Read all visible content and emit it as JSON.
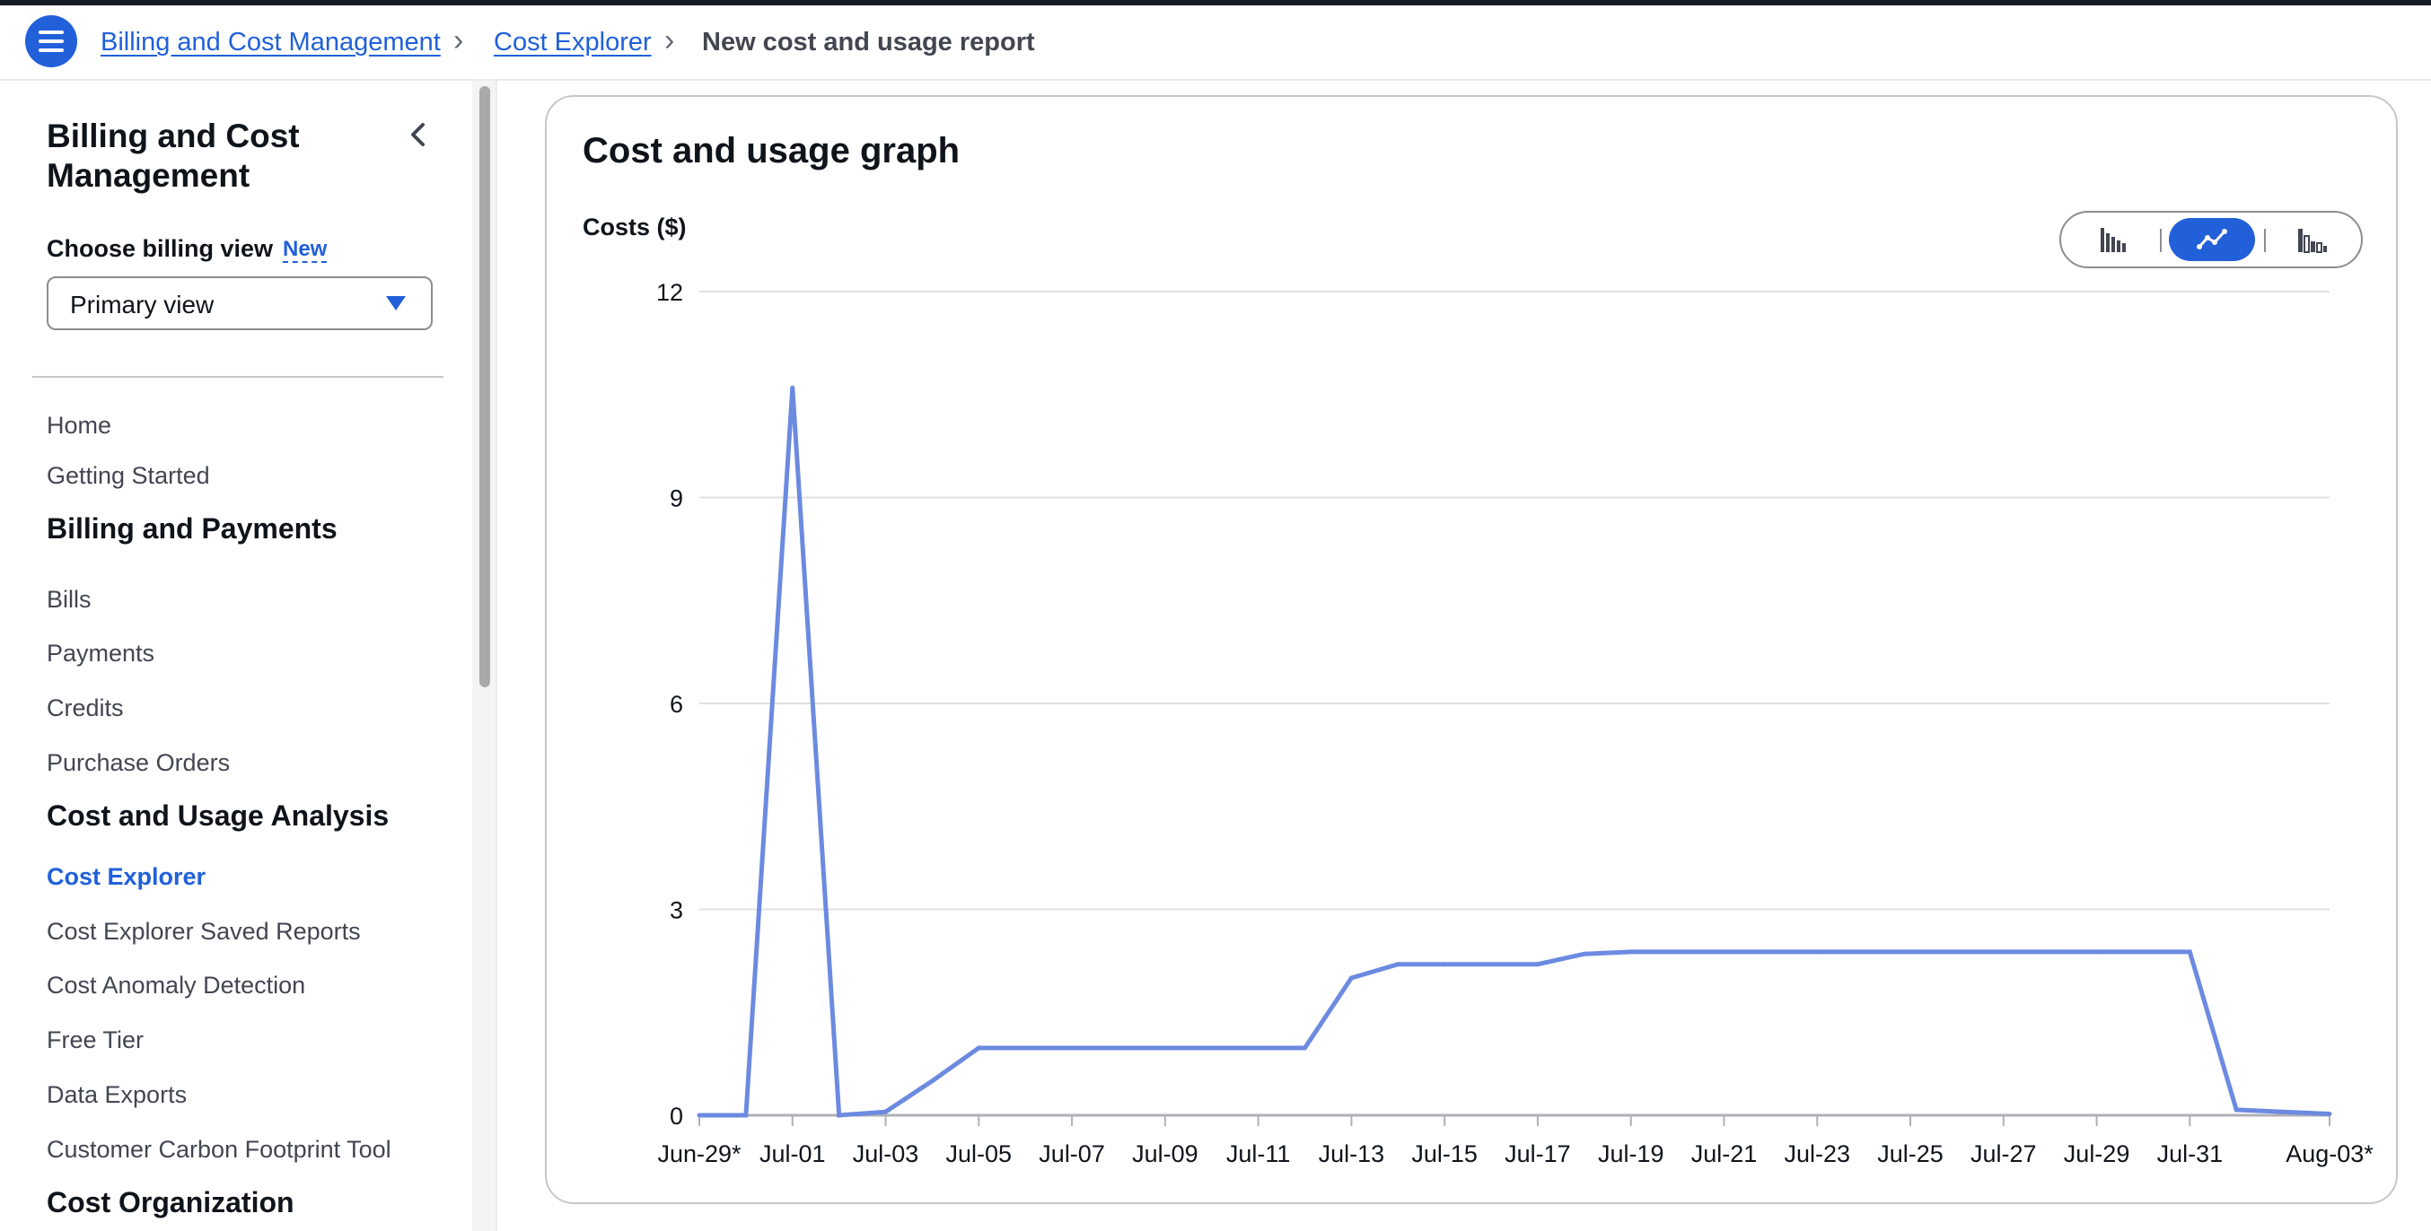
{
  "breadcrumb": {
    "items": [
      "Billing and Cost Management",
      "Cost Explorer"
    ],
    "current": "New cost and usage report"
  },
  "sidebar": {
    "title": "Billing and Cost Management",
    "billing_view_label": "Choose billing view",
    "new_badge": "New",
    "billing_view_value": "Primary view",
    "items": [
      {
        "label": "Home",
        "kind": "link"
      },
      {
        "label": "Getting Started",
        "kind": "link"
      },
      {
        "label": "Billing and Payments",
        "kind": "section"
      },
      {
        "label": "Bills",
        "kind": "link"
      },
      {
        "label": "Payments",
        "kind": "link"
      },
      {
        "label": "Credits",
        "kind": "link"
      },
      {
        "label": "Purchase Orders",
        "kind": "link"
      },
      {
        "label": "Cost and Usage Analysis",
        "kind": "section"
      },
      {
        "label": "Cost Explorer",
        "kind": "link",
        "active": true
      },
      {
        "label": "Cost Explorer Saved Reports",
        "kind": "link"
      },
      {
        "label": "Cost Anomaly Detection",
        "kind": "link"
      },
      {
        "label": "Free Tier",
        "kind": "link"
      },
      {
        "label": "Data Exports",
        "kind": "link"
      },
      {
        "label": "Customer Carbon Footprint Tool",
        "kind": "link"
      },
      {
        "label": "Cost Organization",
        "kind": "section"
      }
    ]
  },
  "card": {
    "title": "Cost and usage graph",
    "chart_type_buttons": [
      {
        "icon": "bar-chart-icon",
        "active": false
      },
      {
        "icon": "line-chart-icon",
        "active": true
      },
      {
        "icon": "stacked-bar-chart-icon",
        "active": false
      }
    ]
  },
  "colors": {
    "accent": "#2160d9",
    "series": "#6b8ae0",
    "grid": "#e0e0e0"
  },
  "chart_data": {
    "type": "line",
    "title": "",
    "ylabel": "Costs ($)",
    "xlabel": "",
    "ylim": [
      0,
      12
    ],
    "yticks": [
      0,
      3,
      6,
      9,
      12
    ],
    "grid": true,
    "x": [
      "Jun-29*",
      "Jun-30",
      "Jul-01",
      "Jul-02",
      "Jul-03",
      "Jul-04",
      "Jul-05",
      "Jul-06",
      "Jul-07",
      "Jul-08",
      "Jul-09",
      "Jul-10",
      "Jul-11",
      "Jul-12",
      "Jul-13",
      "Jul-14",
      "Jul-15",
      "Jul-16",
      "Jul-17",
      "Jul-18",
      "Jul-19",
      "Jul-20",
      "Jul-21",
      "Jul-22",
      "Jul-23",
      "Jul-24",
      "Jul-25",
      "Jul-26",
      "Jul-27",
      "Jul-28",
      "Jul-29",
      "Jul-30",
      "Jul-31",
      "Aug-01",
      "Aug-02",
      "Aug-03*"
    ],
    "xtick_labels": [
      "Jun-29*",
      "Jul-01",
      "Jul-03",
      "Jul-05",
      "Jul-07",
      "Jul-09",
      "Jul-11",
      "Jul-13",
      "Jul-15",
      "Jul-17",
      "Jul-19",
      "Jul-21",
      "Jul-23",
      "Jul-25",
      "Jul-27",
      "Jul-29",
      "Jul-31",
      "Aug-03*"
    ],
    "series": [
      {
        "values": [
          0,
          0,
          10.6,
          0,
          0.05,
          0.5,
          0.98,
          0.98,
          0.98,
          0.98,
          0.98,
          0.98,
          0.98,
          0.98,
          2.0,
          2.2,
          2.2,
          2.2,
          2.2,
          2.35,
          2.38,
          2.38,
          2.38,
          2.38,
          2.38,
          2.38,
          2.38,
          2.38,
          2.38,
          2.38,
          2.38,
          2.38,
          2.38,
          0.08,
          0.05,
          0.02
        ]
      }
    ]
  }
}
